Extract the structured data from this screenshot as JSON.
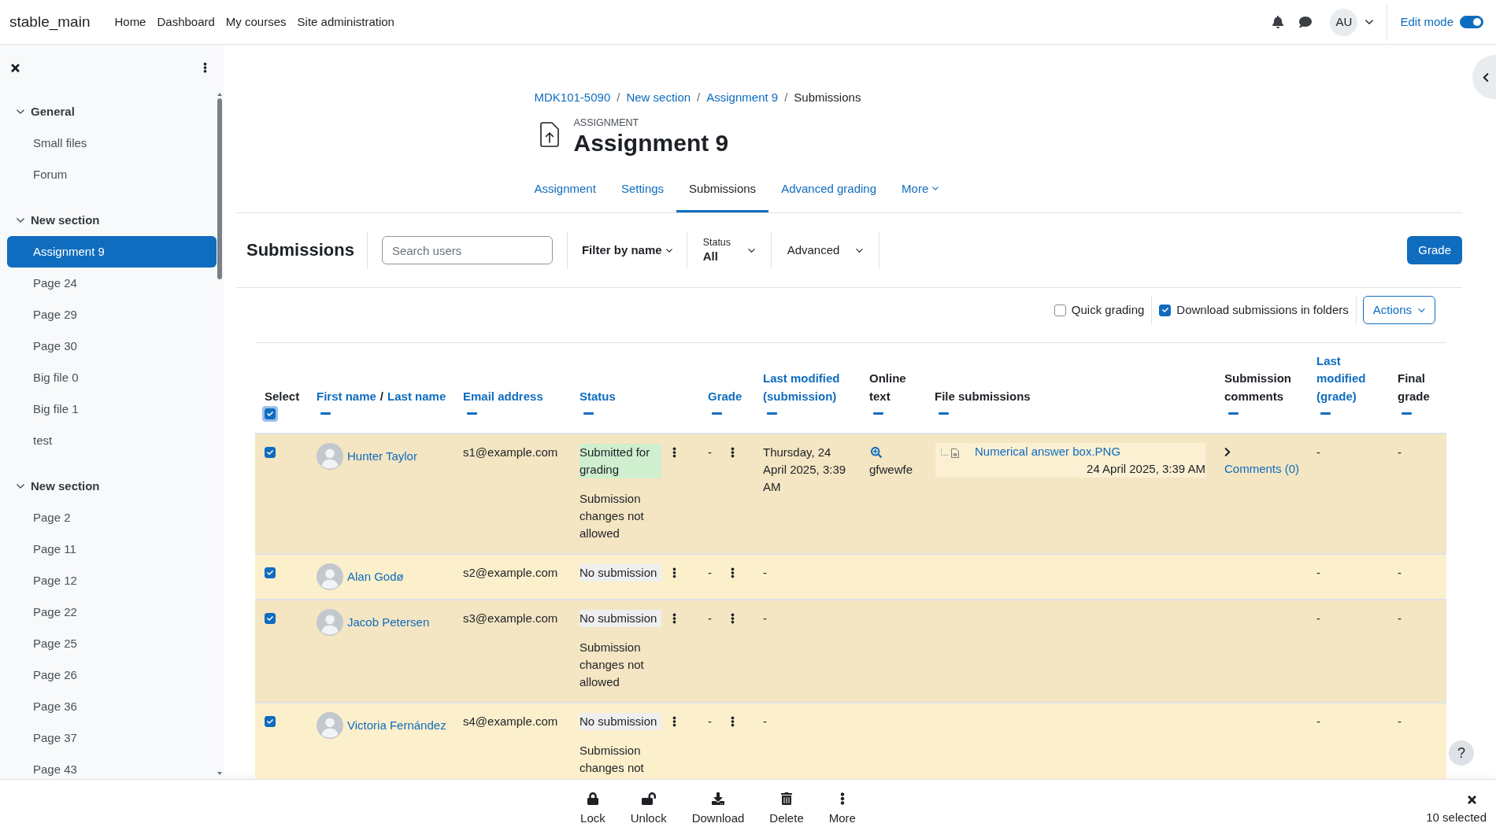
{
  "navbar": {
    "brand": "stable_main",
    "links": [
      "Home",
      "Dashboard",
      "My courses",
      "Site administration"
    ],
    "user_initials": "AU",
    "edit_mode": {
      "label": "Edit mode",
      "on": true
    }
  },
  "sidebar": {
    "sections": [
      {
        "title": "General",
        "expanded": true,
        "items": [
          {
            "label": "Small files",
            "selected": false
          },
          {
            "label": "Forum",
            "selected": false
          }
        ]
      },
      {
        "title": "New section",
        "expanded": true,
        "items": [
          {
            "label": "Assignment 9",
            "selected": true
          },
          {
            "label": "Page 24",
            "selected": false
          },
          {
            "label": "Page 29",
            "selected": false
          },
          {
            "label": "Page 30",
            "selected": false
          },
          {
            "label": "Big file 0",
            "selected": false
          },
          {
            "label": "Big file 1",
            "selected": false
          },
          {
            "label": "test",
            "selected": false
          }
        ]
      },
      {
        "title": "New section",
        "expanded": true,
        "items": [
          {
            "label": "Page 2",
            "selected": false
          },
          {
            "label": "Page 11",
            "selected": false
          },
          {
            "label": "Page 12",
            "selected": false
          },
          {
            "label": "Page 22",
            "selected": false
          },
          {
            "label": "Page 25",
            "selected": false
          },
          {
            "label": "Page 26",
            "selected": false
          },
          {
            "label": "Page 36",
            "selected": false
          },
          {
            "label": "Page 37",
            "selected": false
          },
          {
            "label": "Page 43",
            "selected": false
          }
        ]
      }
    ]
  },
  "breadcrumb": [
    {
      "label": "MDK101-5090",
      "link": true,
      "separator": "/"
    },
    {
      "label": "New section",
      "link": true,
      "separator": "/"
    },
    {
      "label": "Assignment 9",
      "link": true,
      "separator": "/"
    },
    {
      "label": "Submissions",
      "link": false
    }
  ],
  "page_header": {
    "overline": "ASSIGNMENT",
    "title": "Assignment 9"
  },
  "tabs": [
    {
      "label": "Assignment",
      "selected": false
    },
    {
      "label": "Settings",
      "selected": false
    },
    {
      "label": "Submissions",
      "selected": true
    },
    {
      "label": "Advanced grading",
      "selected": false
    },
    {
      "label": "More",
      "selected": false,
      "menu": true
    }
  ],
  "toolbar": {
    "heading": "Submissions",
    "search": {
      "placeholder": "Search users"
    },
    "name_filter": "Filter by name",
    "status_filter": {
      "label": "Status",
      "value": "All"
    },
    "advanced": "Advanced",
    "grade_button": "Grade"
  },
  "options": {
    "checkboxes": [
      {
        "label": "Quick grading",
        "checked": false
      },
      {
        "label": "Download submissions in folders",
        "checked": true
      }
    ],
    "actions": "Actions"
  },
  "table": {
    "select_column": {
      "label": "Select",
      "checked": true
    },
    "columns": [
      {
        "labels": [
          "First name",
          "Last name"
        ],
        "separator": "/",
        "sortable": true
      },
      {
        "label": "Email address",
        "sortable": true
      },
      {
        "label": "Status",
        "sortable": true
      },
      {
        "label": "Grade",
        "sortable": true
      },
      {
        "label": "Last modified (submission)",
        "sortable": true
      },
      {
        "label": "Online text",
        "sortable": false
      },
      {
        "label": "File submissions",
        "sortable": false
      },
      {
        "label": "Submission comments",
        "sortable": false
      },
      {
        "label": "Last modified (grade)",
        "sortable": true
      },
      {
        "label": "Final grade",
        "sortable": false
      }
    ],
    "rows": [
      {
        "selected": true,
        "name": "Hunter Taylor",
        "email": "s1@example.com",
        "status": {
          "text": "Submitted for grading",
          "kind": "submitted"
        },
        "status_note": "Submission changes not allowed",
        "grade": "-",
        "last_modified": "Thursday, 24 April 2025, 3:39 AM",
        "online_text": "gfwewfe",
        "file": {
          "name": "Numerical answer box.PNG",
          "date": "24 April 2025, 3:39 AM"
        },
        "comments": "Comments (0)",
        "last_modified_grade": "-",
        "final_grade": "-"
      },
      {
        "selected": true,
        "name": "Alan Godø",
        "email": "s2@example.com",
        "status": {
          "text": "No submission",
          "kind": "none"
        },
        "grade": "-",
        "last_modified": "-",
        "last_modified_grade": "-",
        "final_grade": "-"
      },
      {
        "selected": true,
        "name": "Jacob Petersen",
        "email": "s3@example.com",
        "status": {
          "text": "No submission",
          "kind": "none"
        },
        "status_note": "Submission changes not allowed",
        "grade": "-",
        "last_modified": "-",
        "last_modified_grade": "-",
        "final_grade": "-"
      },
      {
        "selected": true,
        "name": "Victoria Fernández",
        "email": "s4@example.com",
        "status": {
          "text": "No submission",
          "kind": "none"
        },
        "status_note": "Submission changes not",
        "grade": "-",
        "last_modified": "-",
        "last_modified_grade": "-",
        "final_grade": "-"
      }
    ]
  },
  "bulk_bar": {
    "actions": [
      {
        "label": "Lock",
        "kind": "lock"
      },
      {
        "label": "Unlock",
        "kind": "unlock"
      },
      {
        "label": "Download",
        "kind": "download"
      },
      {
        "label": "Delete",
        "kind": "delete"
      },
      {
        "label": "More",
        "kind": "more"
      }
    ],
    "count": "10 selected"
  },
  "help_button": "?"
}
